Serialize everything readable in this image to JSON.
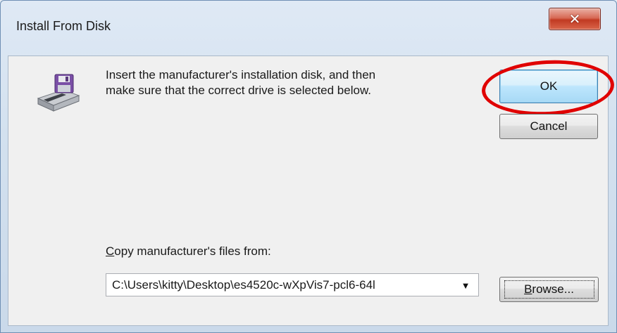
{
  "window": {
    "title": "Install From Disk",
    "close_glyph": "✕"
  },
  "message": {
    "line1": "Insert the manufacturer's installation disk, and then",
    "line2": "make sure that the correct drive is selected below."
  },
  "buttons": {
    "ok_label": "OK",
    "cancel_label": "Cancel",
    "browse_label_underlined": "B",
    "browse_label_rest": "rowse..."
  },
  "copy_from": {
    "label_underlined": "C",
    "label_rest": "opy manufacturer's files from:",
    "value": "C:\\Users\\kitty\\Desktop\\es4520c-wXpVis7-pcl6-64l"
  },
  "annotation": {
    "highlight_color": "#e00000",
    "highlight_target": "ok-button"
  },
  "icons": {
    "disk": "floppy-disk-drive-icon",
    "dropdown": "chevron-down-icon"
  }
}
